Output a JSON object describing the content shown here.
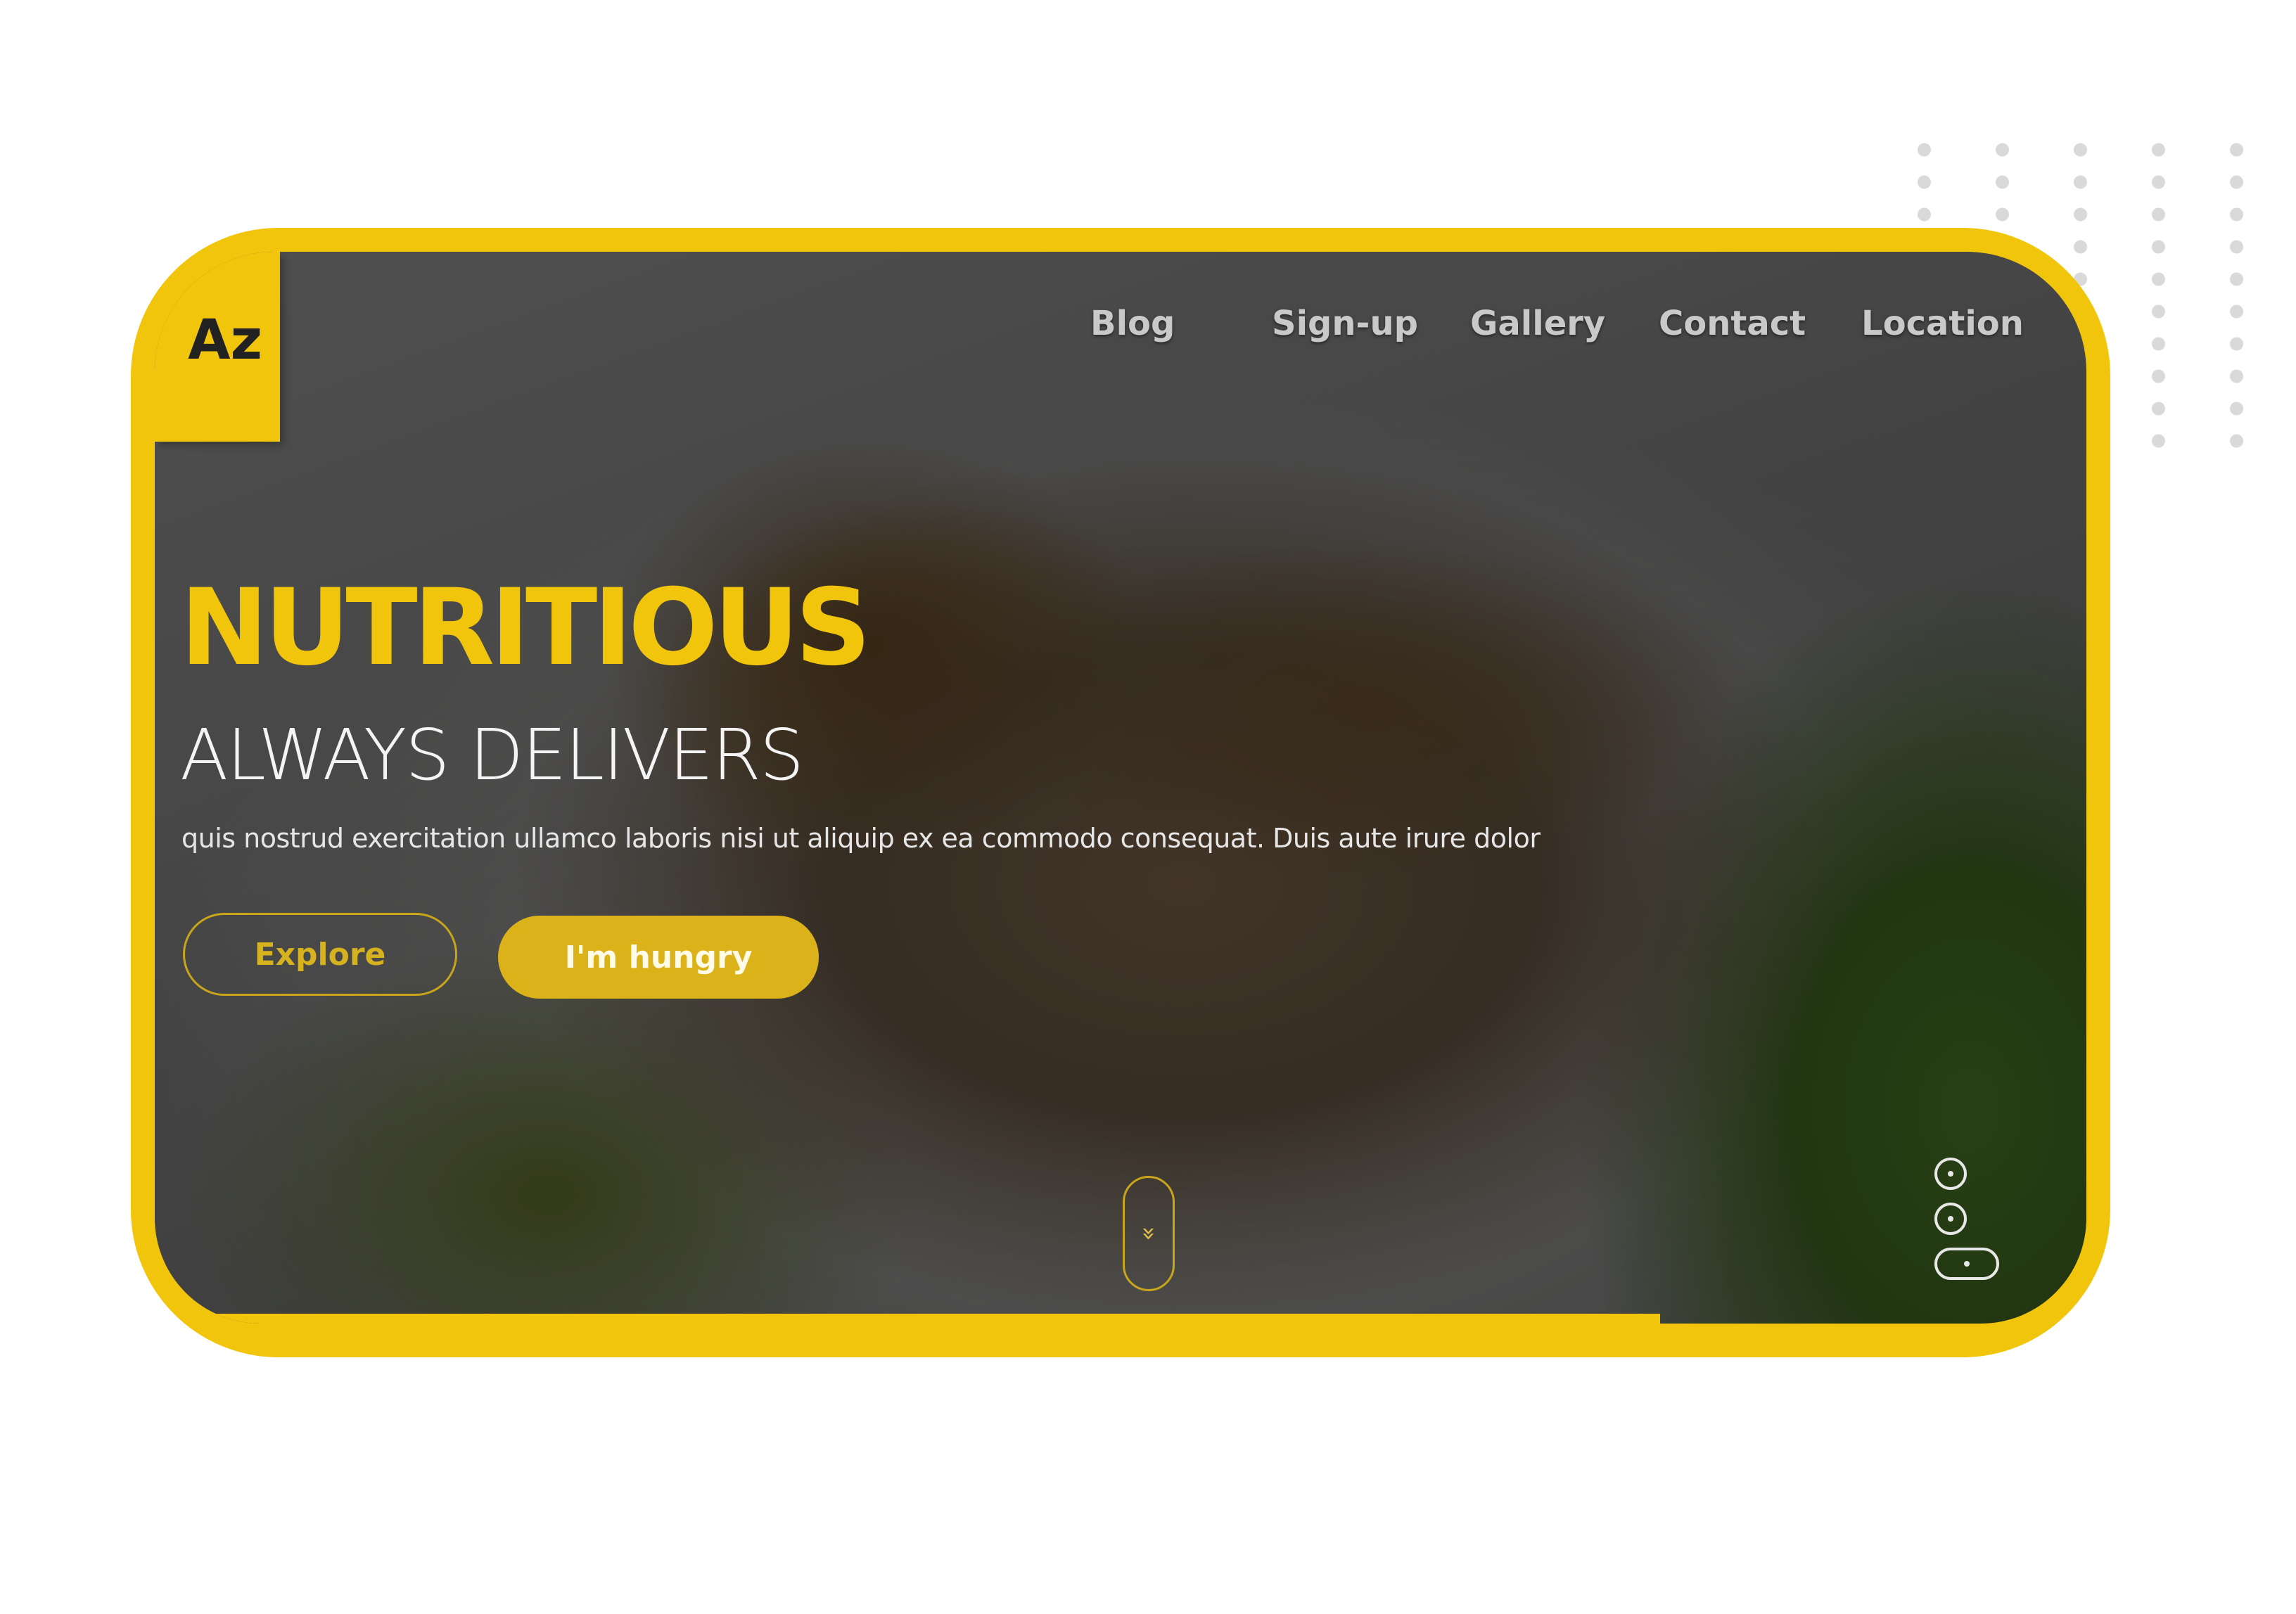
{
  "logo": {
    "text": "Az"
  },
  "nav": {
    "items": [
      {
        "label": "Blog"
      },
      {
        "label": "Sign-up"
      },
      {
        "label": "Gallery"
      },
      {
        "label": "Contact"
      },
      {
        "label": "Location"
      }
    ]
  },
  "hero": {
    "title": "NUTRITIOUS",
    "subtitle": "ALWAYS DELIVERS",
    "description": "quis nostrud exercitation ullamco laboris nisi ut aliquip ex ea commodo consequat. Duis aute irure dolor"
  },
  "buttons": {
    "explore": "Explore",
    "hungry": "I'm hungry"
  },
  "scroll_indicator": {
    "icon": "double-chevron-down-icon",
    "glyph": "»"
  },
  "slider": {
    "total": 3,
    "active": 3
  },
  "colors": {
    "accent": "#f2c50d",
    "nav_text": "#c9c9c9",
    "headline_secondary": "#f4f4f4"
  }
}
